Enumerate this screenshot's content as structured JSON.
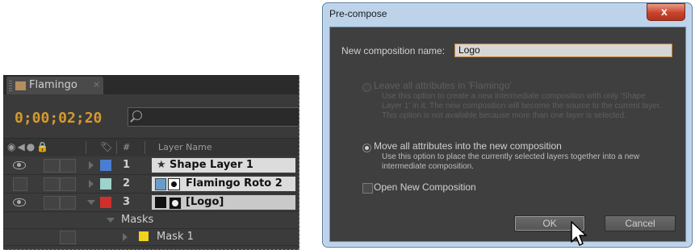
{
  "timeline": {
    "tab_title": "Flamingo",
    "tab_close": "×",
    "timecode": "0;00;02;20",
    "headers": {
      "switches": "👁◀)●🔒",
      "label": "🏷",
      "hash": "#",
      "layer_name": "Layer Name"
    },
    "layers": [
      {
        "num": "1",
        "name": "Shape Layer 1",
        "label_color": "#4a7ed0"
      },
      {
        "num": "2",
        "name": "Flamingo Roto 2",
        "label_color": "#9fd2cc"
      },
      {
        "num": "3",
        "name": "[Logo]",
        "label_color": "#d0302c"
      }
    ],
    "masks_label": "Masks",
    "mask_item": {
      "name": "Mask 1",
      "color": "#f2d21c"
    }
  },
  "dialog": {
    "title": "Pre-compose",
    "close": "x",
    "name_label": "New composition name:",
    "name_value": "Logo",
    "option1_label": "Leave all attributes in 'Flamingo'",
    "option1_desc": "Use this option to create a new intermediate composition with only 'Shape Layer 1' in it. The new composition will become the source to the current layer. This option is not available because more than one layer is selected.",
    "option2_label": "Move all attributes into the new composition",
    "option2_desc": "Use this option to place the currently selected layers together into a new intermediate composition.",
    "open_new_label": "Open New Composition",
    "ok_label": "OK",
    "cancel_label": "Cancel"
  }
}
